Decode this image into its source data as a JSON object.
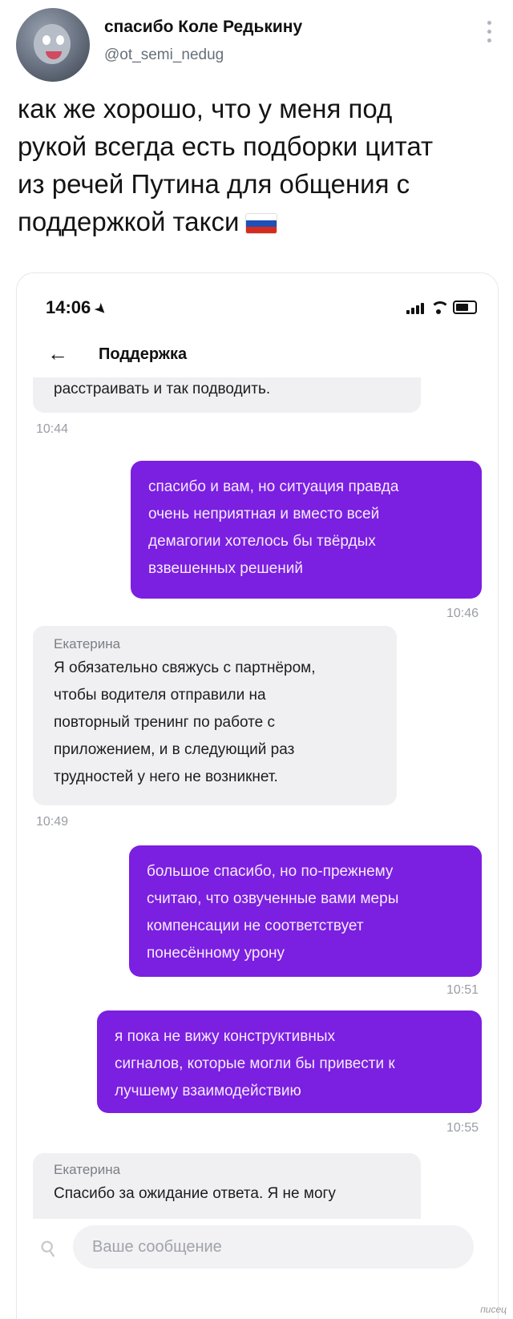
{
  "tweet": {
    "author_name": "спасибо Коле Редькину",
    "author_handle": "@ot_semi_nedug",
    "text_lines": [
      "как же хорошо, что у меня под",
      "рукой всегда есть подборки цитат",
      "из речей Путина для общения с",
      "поддержкой такси"
    ],
    "flag_colors": [
      "#ffffff",
      "#1f4fb8",
      "#d52b1e"
    ]
  },
  "phone": {
    "status_time": "14:06",
    "nav_title": "Поддержка"
  },
  "chat": {
    "messages": [
      {
        "direction": "in",
        "sender": "",
        "lines": [
          "расстраивать и так подводить."
        ],
        "time": "10:44"
      },
      {
        "direction": "out",
        "lines": [
          "спасибо и вам, но ситуация правда",
          "очень неприятная и вместо всей",
          "демагогии хотелось бы твёрдых",
          "взвешенных решений"
        ],
        "time": "10:46"
      },
      {
        "direction": "in",
        "sender": "Екатерина",
        "lines": [
          "Я обязательно свяжусь с партнёром,",
          "чтобы водителя отправили на",
          "повторный тренинг по работе с",
          "приложением, и в следующий раз",
          "трудностей у него не возникнет."
        ],
        "time": "10:49"
      },
      {
        "direction": "out",
        "lines": [
          "большое спасибо, но по-прежнему",
          "считаю, что озвученные вами меры",
          "компенсации не соответствует",
          "понесённому урону"
        ],
        "time": "10:51"
      },
      {
        "direction": "out",
        "lines": [
          "я пока не вижу конструктивных",
          "сигналов, которые могли бы привести к",
          "лучшему взаимодействию"
        ],
        "time": "10:55"
      },
      {
        "direction": "in",
        "sender": "Екатерина",
        "lines": [
          "Спасибо за ожидание ответа. Я не могу"
        ],
        "time": ""
      }
    ],
    "accent_color": "#7b1fe0"
  },
  "composer": {
    "placeholder": "Ваше сообщение"
  },
  "watermark": "писец"
}
